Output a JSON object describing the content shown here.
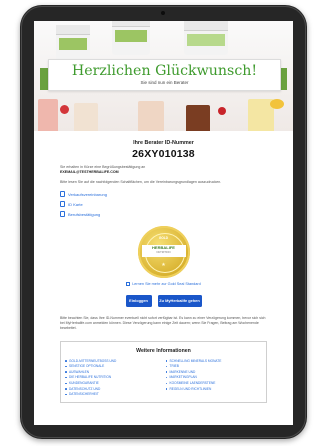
{
  "hero": {
    "title": "Herzlichen Glückwunsch!",
    "subtitle": "Sie sind nun ein Berater"
  },
  "id_section": {
    "label": "Ihre Berater ID-Nummer",
    "number": "26XY010138"
  },
  "intro": {
    "text_1": "Sie erhalten in Kürze eine Begrüßungsbestätigung an",
    "email": "EXEMAIL@TESTHERBALIFE.COM",
    "text_2": "Bitte lesen Sie auf die nachfolgenden Schaltflächen, um die Vereinbarungsgrundlagen auszudrucken."
  },
  "documents": [
    {
      "label": "Verkaufsvereinbarung"
    },
    {
      "label": "ID Karte"
    },
    {
      "label": "Berufsbestätigung"
    }
  ],
  "seal": {
    "top_text": "GOLD",
    "brand": "HERBALIFE",
    "tagline": "NUTRITION",
    "link": "Lernen Sie mehr zur Gold Seal Standard"
  },
  "buttons": {
    "primary_1": "Einloggen",
    "primary_2": "Zu MyHerbalife gehen"
  },
  "bottom_text": "Bitte beachten Sie, dass Ihre ID-Nummer eventuell nicht sofort verfügbar ist. Es kann zu einer Verzögerung kommen, bevor sich sich bei MyHerbalife.com anmelden können. Diese Verzögerung kann einige Zeit dauern; wenn Sie Fragen, Beitrag am Wochenende bearbeitet.",
  "info": {
    "title": "Weitere Informationen",
    "col_left": [
      "GOLD-MITTERNEUTBOSS UND",
      "SENSTIGE OPTIONALE",
      "AUSWAHLEN",
      "DIE HERBALIFE NUTRITION",
      "KUNDENGARANTIE",
      "DATENSCHUTZ UND",
      "DATENSICHERHEIT"
    ],
    "col_right": [
      "SCHNELLING MINERALS MONATE",
      "TRIEB",
      "MARKENNE UND",
      "MARKETINGPLAN",
      "KOOSMEINE LAENDERSTENE",
      "REGELN UND RICHTLINIEN"
    ]
  },
  "colors": {
    "accent_green": "#3f9b2e",
    "link_blue": "#2a6fdb",
    "button_blue": "#1a56c9",
    "gold": "#d8b12e",
    "tablet_frame": "#262626"
  }
}
